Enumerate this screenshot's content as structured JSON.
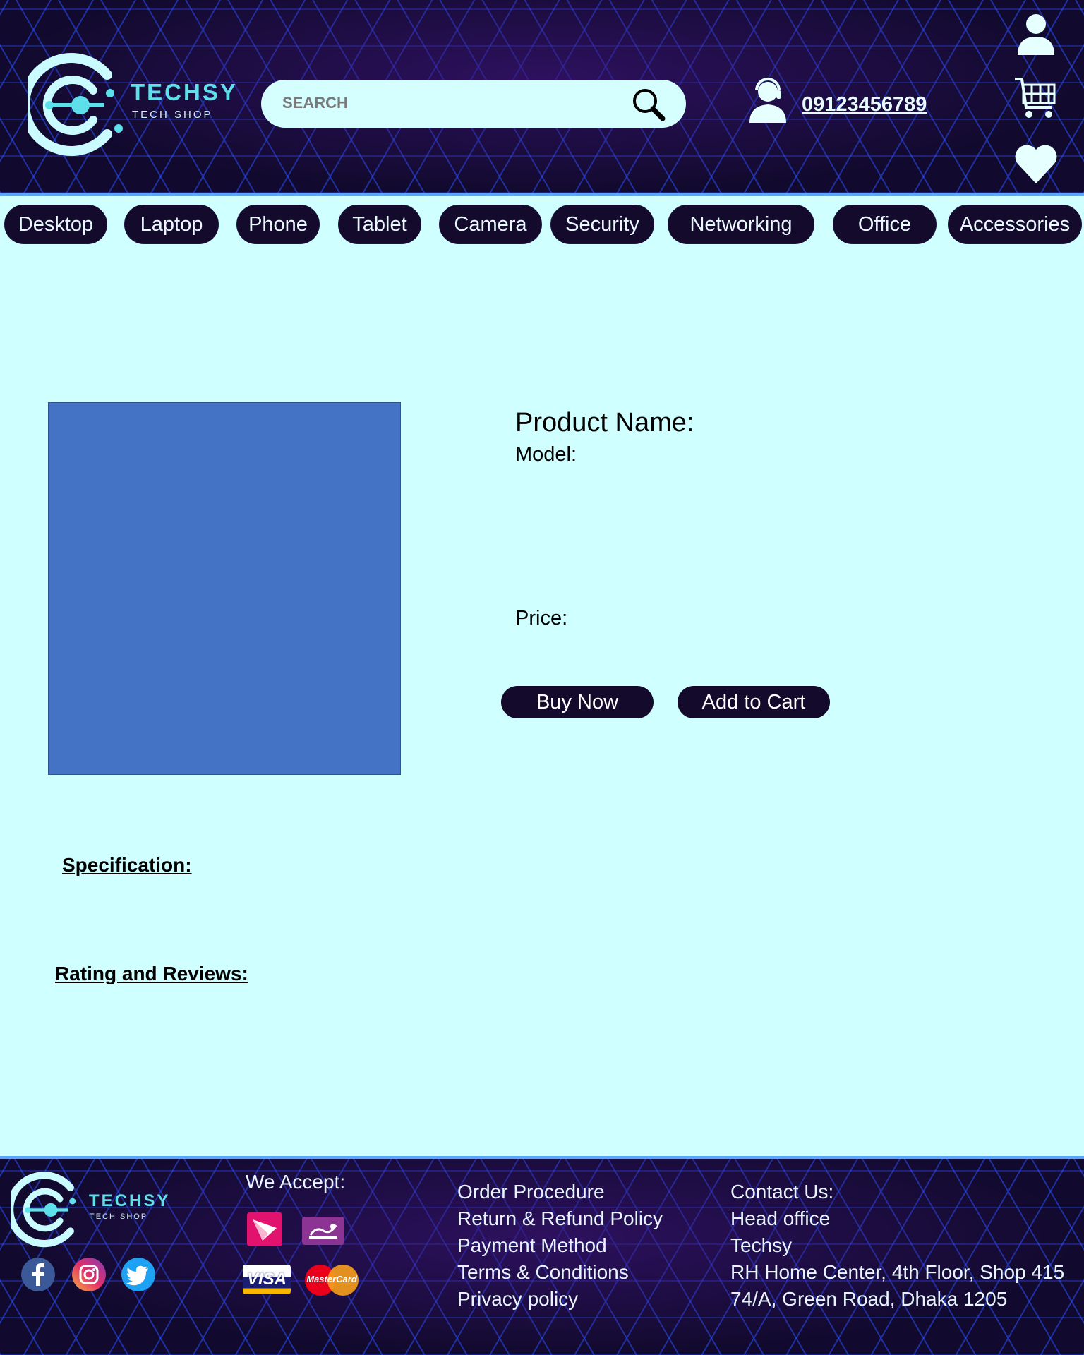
{
  "header": {
    "brand_name": "TECHSY",
    "brand_tagline": "TECH SHOP",
    "search_placeholder": "SEARCH",
    "phone": "09123456789",
    "icons": [
      "user-icon",
      "cart-icon",
      "heart-icon",
      "support-icon",
      "search-icon"
    ]
  },
  "nav": {
    "items": [
      "Desktop",
      "Laptop",
      "Phone",
      "Tablet",
      "Camera",
      "Security",
      "Networking",
      "Office",
      "Accessories"
    ]
  },
  "product": {
    "name_label": "Product Name:",
    "model_label": "Model:",
    "price_label": "Price:",
    "buy_label": "Buy Now",
    "cart_label": "Add to Cart"
  },
  "sections": {
    "specification": "Specification:",
    "reviews": "Rating and Reviews:"
  },
  "footer": {
    "brand_name": "TECHSY",
    "brand_tagline": "TECH SHOP",
    "accept_label": "We Accept:",
    "links": [
      "Order Procedure",
      "Return & Refund Policy",
      "Payment Method",
      "Terms & Conditions",
      "Privacy policy"
    ],
    "contact": [
      "Contact Us:",
      "Head office",
      "Techsy",
      "RH Home Center, 4th Floor, Shop 415",
      "74/A, Green Road, Dhaka 1205"
    ],
    "payment_logos": {
      "visa": "VISA",
      "mastercard": "MasterCard"
    }
  },
  "colors": {
    "background": "#d0ffff",
    "dark": "#130a2c",
    "accent": "#5ee0ea",
    "product_image": "#4472c4"
  }
}
